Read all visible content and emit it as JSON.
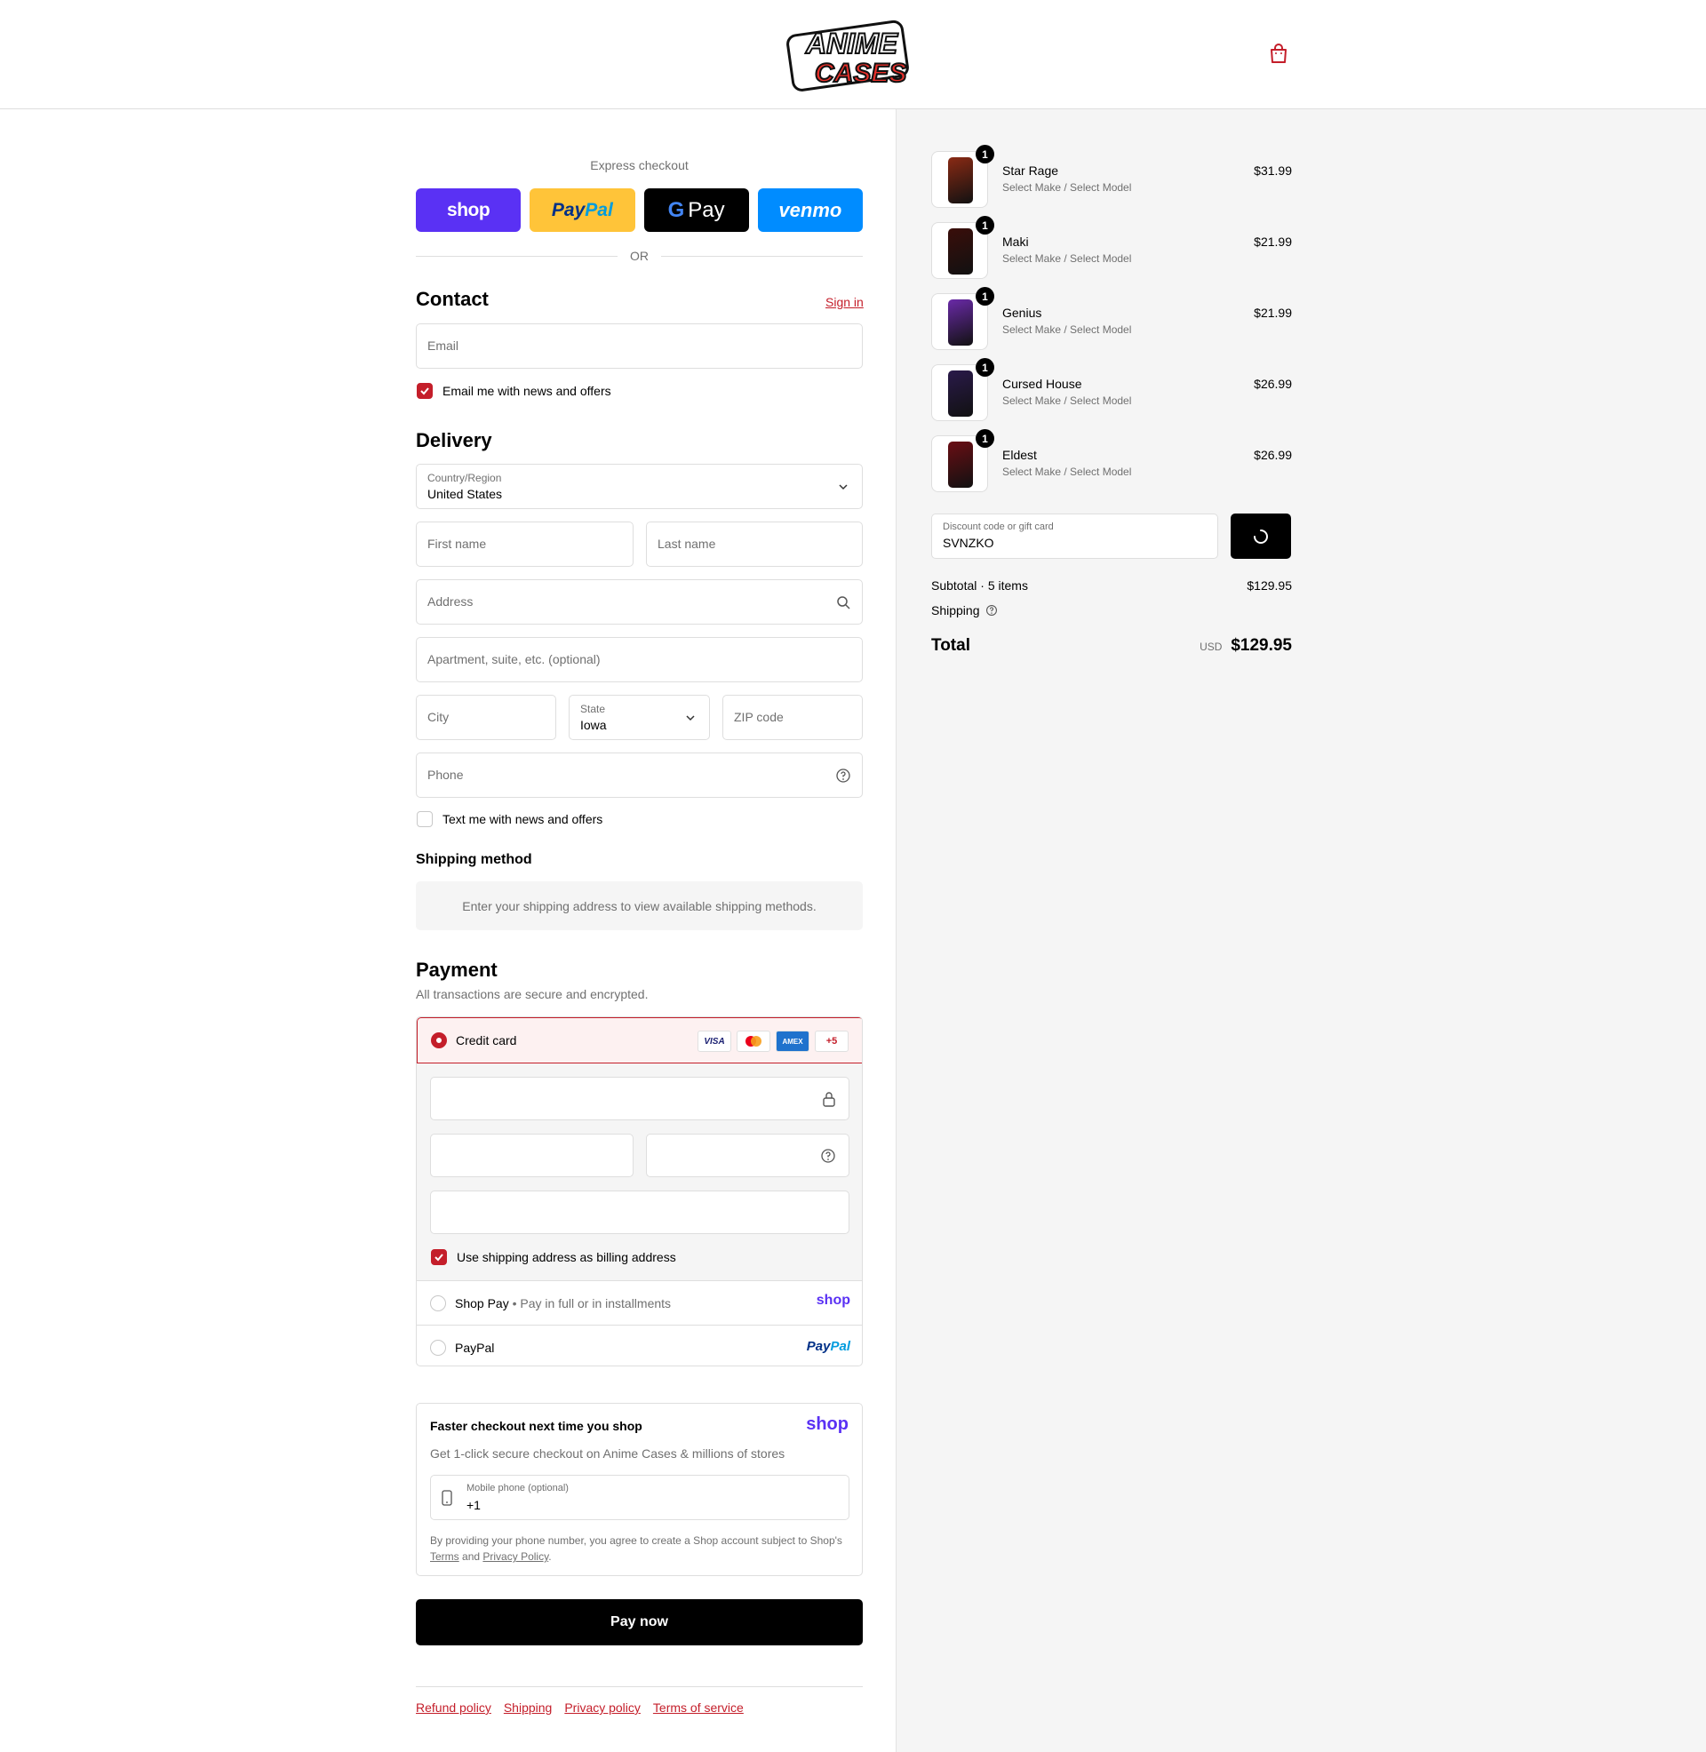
{
  "brand": {
    "logo_top": "ANIME",
    "logo_bottom": "CASES",
    "accent": "#c41e2a"
  },
  "express": {
    "title": "Express checkout",
    "buttons": {
      "shop": "shop",
      "paypal_a": "Pay",
      "paypal_b": "Pal",
      "gpay_g": "G",
      "gpay": "Pay",
      "venmo": "venmo"
    },
    "or": "OR"
  },
  "contact": {
    "title": "Contact",
    "sign_in": "Sign in",
    "email_placeholder": "Email",
    "email_opt_in": "Email me with news and offers",
    "email_opt_in_checked": true
  },
  "delivery": {
    "title": "Delivery",
    "country_label": "Country/Region",
    "country_value": "United States",
    "first_name": "First name",
    "last_name": "Last name",
    "address": "Address",
    "apartment": "Apartment, suite, etc. (optional)",
    "city": "City",
    "state_label": "State",
    "state_value": "Iowa",
    "zip": "ZIP code",
    "phone": "Phone",
    "text_opt_in": "Text me with news and offers",
    "text_opt_in_checked": false
  },
  "shipping_method": {
    "title": "Shipping method",
    "message": "Enter your shipping address to view available shipping methods."
  },
  "payment": {
    "title": "Payment",
    "subtitle": "All transactions are secure and encrypted.",
    "credit_card": "Credit card",
    "cards": [
      "VISA",
      "MC",
      "AMEX",
      "+5"
    ],
    "billing_same": "Use shipping address as billing address",
    "shop_pay": "Shop Pay",
    "shop_pay_desc": "Pay in full or in installments",
    "shop_pay_logo": "shop",
    "paypal": "PayPal",
    "paypal_logo_a": "Pay",
    "paypal_logo_b": "Pal"
  },
  "shop_promo": {
    "title": "Faster checkout next time you shop",
    "logo": "shop",
    "desc": "Get 1-click secure checkout on Anime Cases & millions of stores",
    "phone_label": "Mobile phone (optional)",
    "phone_value": "+1",
    "legal_a": "By providing your phone number, you agree to create a Shop account subject to Shop's",
    "terms": "Terms",
    "and": "and",
    "privacy": "Privacy Policy",
    "period": "."
  },
  "pay_now": "Pay now",
  "footer": {
    "links": [
      "Refund policy",
      "Shipping",
      "Privacy policy",
      "Terms of service"
    ]
  },
  "summary": {
    "items": [
      {
        "name": "Star Rage",
        "variant": "Select Make / Select Model",
        "price": "$31.99",
        "qty": "1",
        "color": "#8a2a14"
      },
      {
        "name": "Maki",
        "variant": "Select Make / Select Model",
        "price": "$21.99",
        "qty": "1",
        "color": "#3a0e0a"
      },
      {
        "name": "Genius",
        "variant": "Select Make / Select Model",
        "price": "$21.99",
        "qty": "1",
        "color": "#6a2aa8"
      },
      {
        "name": "Cursed House",
        "variant": "Select Make / Select Model",
        "price": "$26.99",
        "qty": "1",
        "color": "#2a1a4a"
      },
      {
        "name": "Eldest",
        "variant": "Select Make / Select Model",
        "price": "$26.99",
        "qty": "1",
        "color": "#6a0e14"
      }
    ],
    "discount_label": "Discount code or gift card",
    "discount_value": "SVNZKO",
    "subtotal_label": "Subtotal · 5 items",
    "subtotal_value": "$129.95",
    "shipping_label": "Shipping",
    "total_label": "Total",
    "currency": "USD",
    "total_value": "$129.95"
  }
}
